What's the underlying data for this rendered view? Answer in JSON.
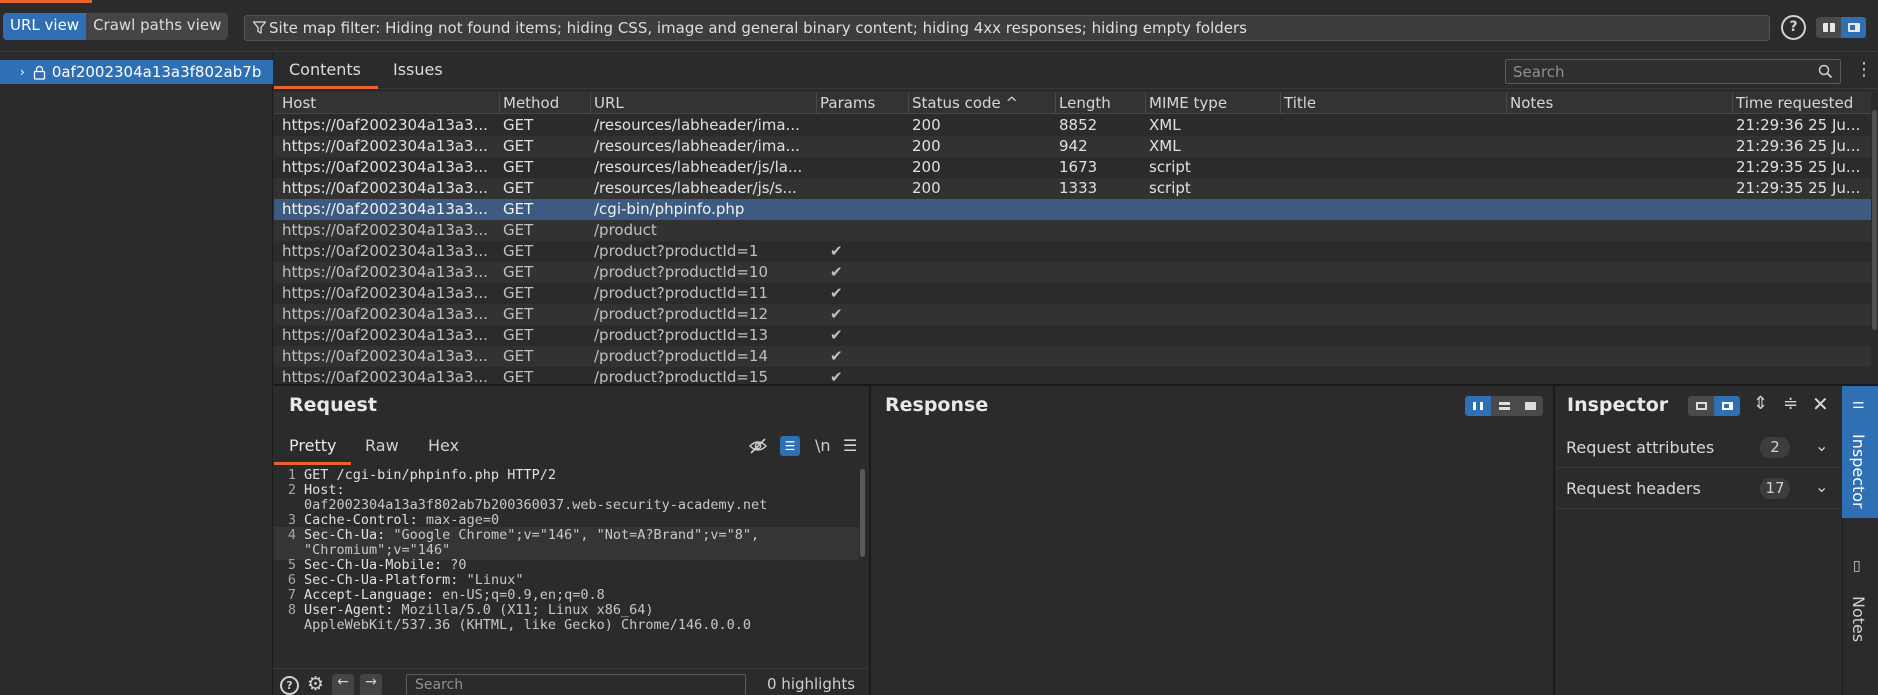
{
  "topbar": {
    "url_view": "URL view",
    "crawl_view": "Crawl paths view",
    "filter_text": "Site map filter: Hiding not found items; hiding CSS, image and general binary content; hiding 4xx responses; hiding empty folders"
  },
  "tree": {
    "root": "0af2002304a13a3f802ab7b"
  },
  "tabs": {
    "contents": "Contents",
    "issues": "Issues",
    "search_placeholder": "Search"
  },
  "table": {
    "columns": [
      "Host",
      "Method",
      "URL",
      "Params",
      "Status code ^",
      "Length",
      "MIME type",
      "Title",
      "Notes",
      "Time requested"
    ],
    "rows": [
      {
        "host": "https://0af2002304a13a3...",
        "method": "GET",
        "url": "/resources/labheader/ima...",
        "params": "",
        "status": "200",
        "length": "8852",
        "mime": "XML",
        "time": "21:29:36 25 Ju..."
      },
      {
        "host": "https://0af2002304a13a3...",
        "method": "GET",
        "url": "/resources/labheader/ima...",
        "params": "",
        "status": "200",
        "length": "942",
        "mime": "XML",
        "time": "21:29:36 25 Ju..."
      },
      {
        "host": "https://0af2002304a13a3...",
        "method": "GET",
        "url": "/resources/labheader/js/la...",
        "params": "",
        "status": "200",
        "length": "1673",
        "mime": "script",
        "time": "21:29:35 25 Ju..."
      },
      {
        "host": "https://0af2002304a13a3...",
        "method": "GET",
        "url": "/resources/labheader/js/s...",
        "params": "",
        "status": "200",
        "length": "1333",
        "mime": "script",
        "time": "21:29:35 25 Ju..."
      },
      {
        "host": "https://0af2002304a13a3...",
        "method": "GET",
        "url": "/cgi-bin/phpinfo.php",
        "params": "",
        "status": "",
        "length": "",
        "mime": "",
        "time": ""
      },
      {
        "host": "https://0af2002304a13a3...",
        "method": "GET",
        "url": "/product",
        "params": "",
        "status": "",
        "length": "",
        "mime": "",
        "time": ""
      },
      {
        "host": "https://0af2002304a13a3...",
        "method": "GET",
        "url": "/product?productId=1",
        "params": "✔",
        "status": "",
        "length": "",
        "mime": "",
        "time": ""
      },
      {
        "host": "https://0af2002304a13a3...",
        "method": "GET",
        "url": "/product?productId=10",
        "params": "✔",
        "status": "",
        "length": "",
        "mime": "",
        "time": ""
      },
      {
        "host": "https://0af2002304a13a3...",
        "method": "GET",
        "url": "/product?productId=11",
        "params": "✔",
        "status": "",
        "length": "",
        "mime": "",
        "time": ""
      },
      {
        "host": "https://0af2002304a13a3...",
        "method": "GET",
        "url": "/product?productId=12",
        "params": "✔",
        "status": "",
        "length": "",
        "mime": "",
        "time": ""
      },
      {
        "host": "https://0af2002304a13a3...",
        "method": "GET",
        "url": "/product?productId=13",
        "params": "✔",
        "status": "",
        "length": "",
        "mime": "",
        "time": ""
      },
      {
        "host": "https://0af2002304a13a3...",
        "method": "GET",
        "url": "/product?productId=14",
        "params": "✔",
        "status": "",
        "length": "",
        "mime": "",
        "time": ""
      },
      {
        "host": "https://0af2002304a13a3...",
        "method": "GET",
        "url": "/product?productId=15",
        "params": "✔",
        "status": "",
        "length": "",
        "mime": "",
        "time": ""
      }
    ]
  },
  "request": {
    "title": "Request",
    "tabs": [
      "Pretty",
      "Raw",
      "Hex"
    ],
    "newline_glyph": "\\n",
    "lines": [
      {
        "n": "1",
        "key": "GET /cgi-bin/phpinfo.php HTTP/2",
        "val": ""
      },
      {
        "n": "2",
        "key": "Host:",
        "val": ""
      },
      {
        "n": "",
        "key": "",
        "val": "0af2002304a13a3f802ab7b200360037.web-security-academy.net"
      },
      {
        "n": "3",
        "key": "Cache-Control:",
        "val": " max-age=0"
      },
      {
        "n": "4",
        "key": "Sec-Ch-Ua:",
        "val": " \"Google Chrome\";v=\"146\", \"Not=A?Brand\";v=\"8\","
      },
      {
        "n": "",
        "key": "",
        "val": "\"Chromium\";v=\"146\""
      },
      {
        "n": "5",
        "key": "Sec-Ch-Ua-Mobile:",
        "val": " ?0"
      },
      {
        "n": "6",
        "key": "Sec-Ch-Ua-Platform:",
        "val": " \"Linux\""
      },
      {
        "n": "7",
        "key": "Accept-Language:",
        "val": " en-US;q=0.9,en;q=0.8"
      },
      {
        "n": "8",
        "key": "User-Agent:",
        "val": " Mozilla/5.0 (X11; Linux x86_64)"
      },
      {
        "n": "",
        "key": "",
        "val": "AppleWebKit/537.36 (KHTML, like Gecko) Chrome/146.0.0.0"
      }
    ],
    "search_placeholder": "Search",
    "highlights": "0 highlights"
  },
  "response": {
    "title": "Response"
  },
  "inspector": {
    "title": "Inspector",
    "rows": [
      {
        "label": "Request attributes",
        "count": "2"
      },
      {
        "label": "Request headers",
        "count": "17"
      }
    ]
  },
  "sidebar": {
    "inspector": "Inspector",
    "notes": "Notes"
  },
  "colors": {
    "accent": "#e8632b",
    "selection": "#2f6fb3",
    "background": "#2b2b2b"
  }
}
